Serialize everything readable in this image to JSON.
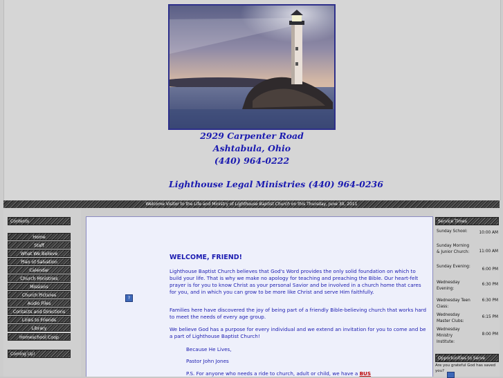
{
  "header": {
    "address_line1": "2929 Carpenter Road",
    "address_line2": "Ashtabula, Ohio",
    "phone": "(440) 964-0222",
    "legal_ministries": "Lighthouse Legal Ministries (440) 964-0236"
  },
  "welcome_bar": {
    "prefix": "Welcome Visitor to the Life and Ministry of ",
    "church_name": "Lighthouse Baptist Church",
    "suffix": " on this Thursday, June 30, 2011"
  },
  "sidebar": {
    "contents_header": "Contents",
    "items": [
      {
        "label": "Home"
      },
      {
        "label": "Staff"
      },
      {
        "label": "What We Believe"
      },
      {
        "label": "Plan of Salvation"
      },
      {
        "label": "Calendar"
      },
      {
        "label": "Church Ministries"
      },
      {
        "label": "Missions"
      },
      {
        "label": "Church Pictures"
      },
      {
        "label": "Audio Files"
      },
      {
        "label": "Contacts and Directions"
      },
      {
        "label": "Links to Friends"
      },
      {
        "label": "Library"
      },
      {
        "label": "Homeschool Coop"
      }
    ],
    "coming_up_header": "Coming Up!"
  },
  "main": {
    "title": "WELCOME, FRIEND!",
    "para1": "Lighthouse Baptist Church believes that God's Word provides the only solid foundation on which to build your life.  That is why we make no apology for teaching and preaching the Bible.  Our heart-felt prayer is for you to know Christ as your personal Savior and be involved in a church home that cares for you, and in which you can grow to be more like Christ and serve Him faithfully.",
    "para2": "Families here have discovered the joy of being part of a friendly Bible-believing church that works hard to meet the needs of every age group.",
    "para3": "We believe God has a purpose for every individual and we extend an invitation for you to come and be a part of Lighthouse Baptist Church!",
    "closing": "Because He Lives,",
    "signature": "Pastor John Jones",
    "ps_prefix": "P.S. For anyone who needs a ride to church, adult or child, we have a ",
    "ps_link": "BUS"
  },
  "service_times": {
    "header": "Service Times",
    "rows": [
      {
        "label": "Sunday School:",
        "time": "10:00 AM"
      },
      {
        "label": "Sunday Morning & Junior Church:",
        "time": "11:00 AM"
      },
      {
        "label": "Sunday Evening:",
        "time": "6:00 PM"
      },
      {
        "label": "Wednesday Evening:",
        "time": "6:30 PM"
      },
      {
        "label": "Wednesday Teen Class:",
        "time": "6:30 PM"
      },
      {
        "label": "Wednesday Master Clubs:",
        "time": "6:15 PM"
      },
      {
        "label": "Wednesday Ministry Institute:",
        "time": "8:00 PM"
      }
    ]
  },
  "opportunities": {
    "header": "Opportunities to Serve",
    "text": "Are you grateful God has saved you?"
  },
  "colors": {
    "accent": "#1a1ab0",
    "panel_bg": "#eef0fb",
    "page_bg": "#cdcdcd",
    "link_red": "#b00000"
  },
  "icons": {
    "help": "question-icon",
    "lighthouse": "lighthouse-image"
  }
}
